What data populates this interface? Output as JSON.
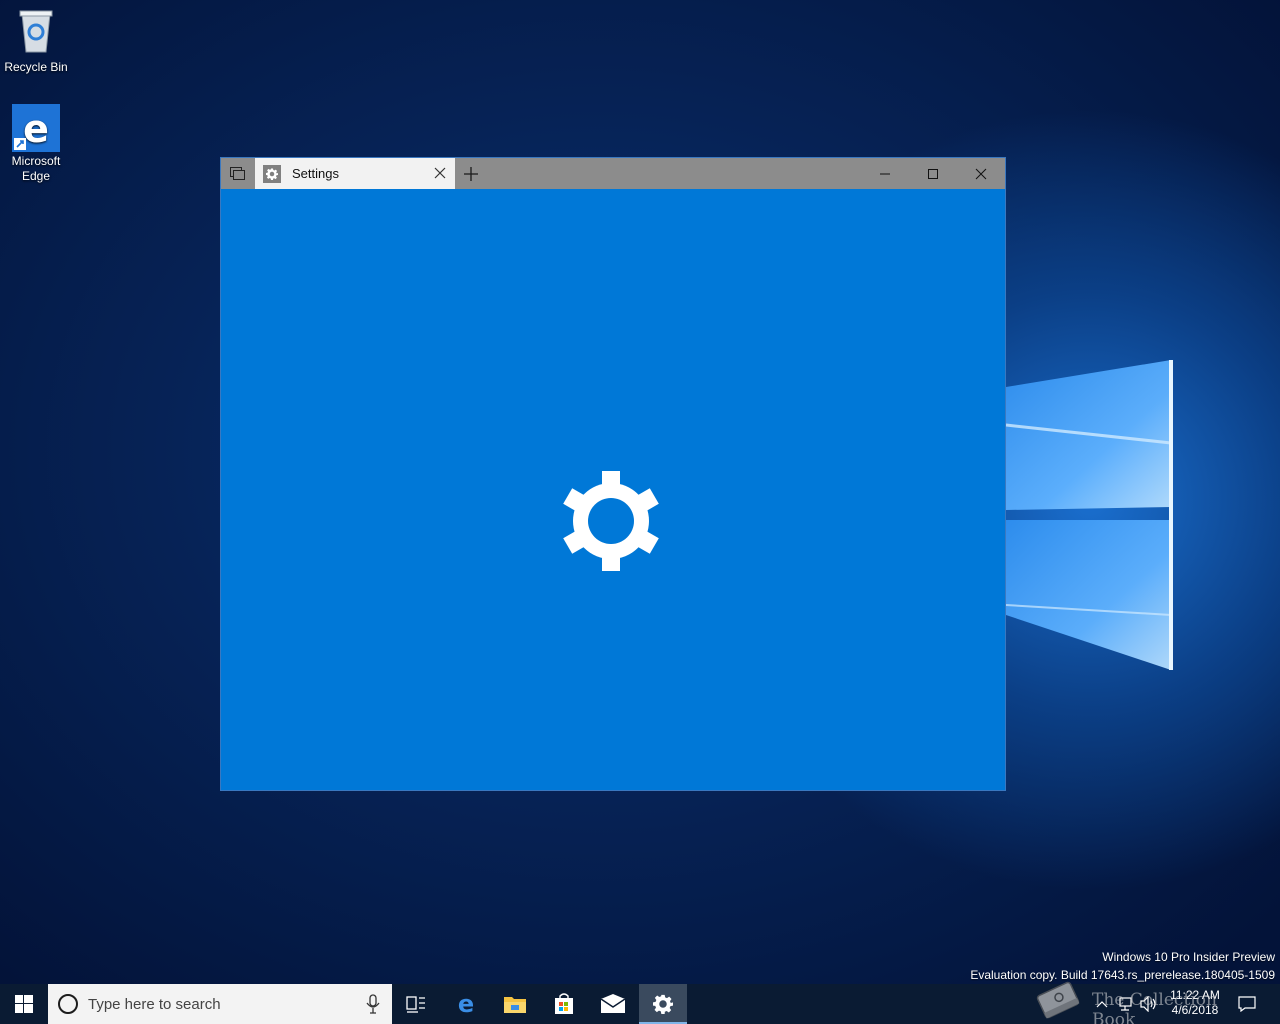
{
  "desktop": {
    "icons": [
      {
        "label_line1": "Recycle Bin",
        "label_line2": ""
      },
      {
        "label_line1": "Microsoft",
        "label_line2": "Edge"
      }
    ]
  },
  "window": {
    "tab_title": "Settings",
    "icon": "gear-icon",
    "background_color": "#0078d7"
  },
  "watermark": {
    "line1": "Windows 10 Pro Insider Preview",
    "line2": "Evaluation copy. Build 17643.rs_prerelease.180405-1509"
  },
  "taskbar": {
    "search_placeholder": "Type here to search",
    "pinned": [
      "task-view-icon",
      "edge-icon",
      "file-explorer-icon",
      "store-icon",
      "mail-icon",
      "settings-icon"
    ],
    "clock_time": "11:22 AM",
    "clock_date": "4/6/2018"
  },
  "overlay_logo": {
    "text": "The Collection Book"
  }
}
